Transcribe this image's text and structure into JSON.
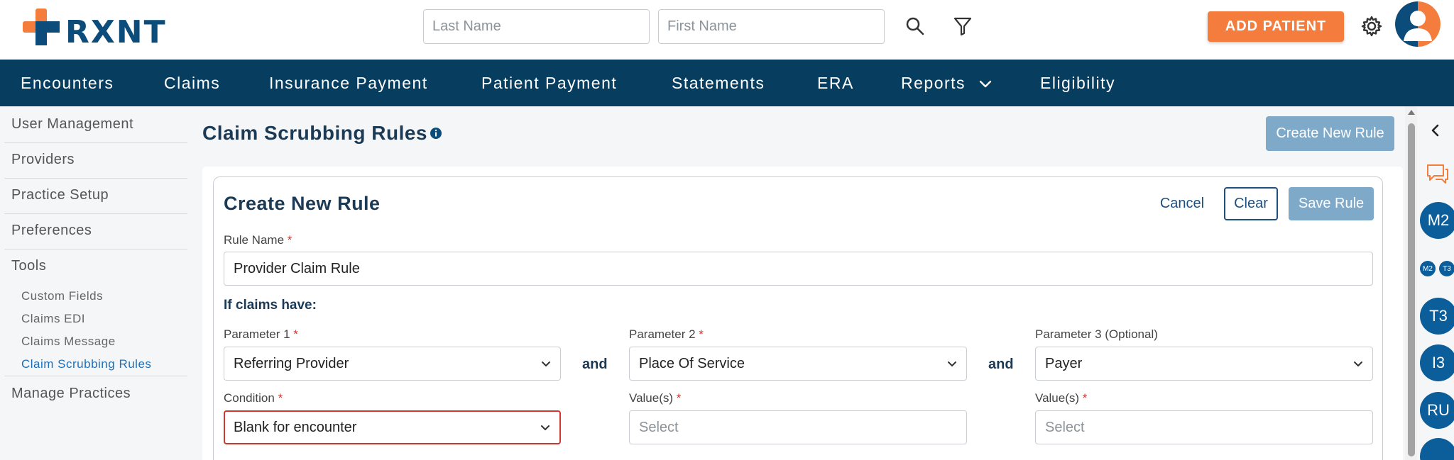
{
  "header": {
    "logo_text": "RXNT",
    "last_name_placeholder": "Last Name",
    "first_name_placeholder": "First Name",
    "add_patient_label": "ADD PATIENT"
  },
  "nav": {
    "items": [
      {
        "label": "Encounters"
      },
      {
        "label": "Claims"
      },
      {
        "label": "Insurance Payment"
      },
      {
        "label": "Patient Payment"
      },
      {
        "label": "Statements"
      },
      {
        "label": "ERA"
      },
      {
        "label": "Reports"
      },
      {
        "label": "Eligibility"
      }
    ]
  },
  "sidebar": {
    "items": [
      {
        "label": "User Management"
      },
      {
        "label": "Providers"
      },
      {
        "label": "Practice Setup"
      },
      {
        "label": "Preferences"
      },
      {
        "label": "Tools"
      }
    ],
    "tools_sub": [
      {
        "label": "Custom Fields"
      },
      {
        "label": "Claims EDI"
      },
      {
        "label": "Claims Message"
      },
      {
        "label": "Claim Scrubbing Rules",
        "active": true
      }
    ],
    "manage_practices": "Manage Practices"
  },
  "page": {
    "title": "Claim Scrubbing Rules",
    "create_new_rule_button": "Create New Rule"
  },
  "form": {
    "title": "Create New Rule",
    "cancel_label": "Cancel",
    "clear_label": "Clear",
    "save_label": "Save Rule",
    "rule_name_label": "Rule Name",
    "rule_name_value": "Provider Claim Rule",
    "if_claims_have": "If claims have:",
    "and_label": "and",
    "parameters": [
      {
        "label": "Parameter 1",
        "required": "*",
        "value": "Referring Provider"
      },
      {
        "label": "Parameter 2",
        "required": "*",
        "value": "Place Of Service"
      },
      {
        "label": "Parameter 3 (Optional)",
        "required": "",
        "value": "Payer"
      }
    ],
    "conditions": [
      {
        "label": "Condition",
        "required": "*",
        "value": "Blank for encounter",
        "placeholder": false
      },
      {
        "label": "Value(s)",
        "required": "*",
        "value": "Select",
        "placeholder": true
      },
      {
        "label": "Value(s)",
        "required": "*",
        "value": "Select",
        "placeholder": true
      }
    ],
    "required_mark": "*"
  },
  "rail": {
    "badges": [
      "M2",
      "T3",
      "I3",
      "RU"
    ],
    "mini_badges": [
      "M2",
      "T3"
    ]
  },
  "colors": {
    "brand_navy": "#073d5f",
    "accent_orange": "#f47c3c",
    "error_red": "#d0352f",
    "muted_button": "#7fa9c9"
  }
}
